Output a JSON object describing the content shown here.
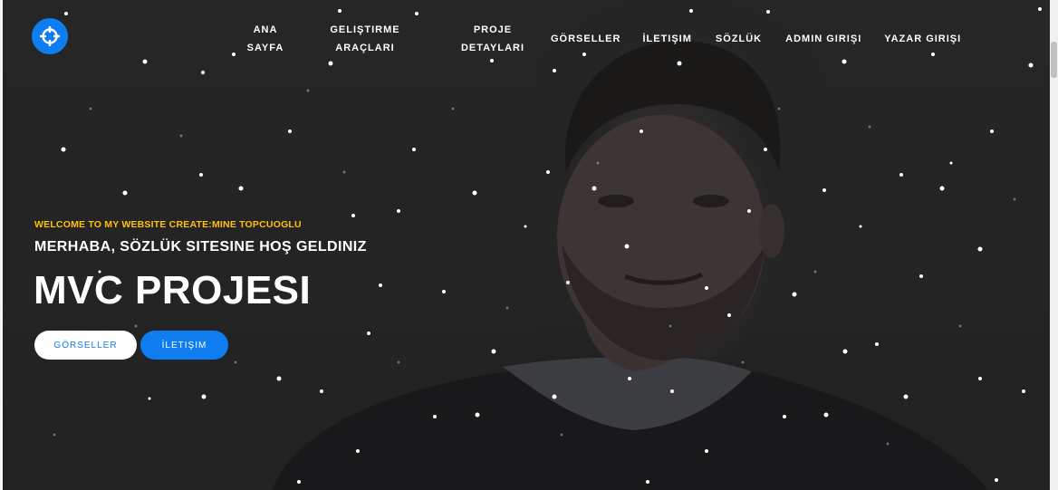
{
  "nav": {
    "items": [
      {
        "label_line1": "ANA",
        "label_line2": "SAYFA"
      },
      {
        "label_line1": "GELIŞTIRME",
        "label_line2": "ARAÇLARI"
      },
      {
        "label_line1": "PROJE",
        "label_line2": "DETAYLARI"
      },
      {
        "label_line1": "GÖRSELLER",
        "label_line2": ""
      },
      {
        "label_line1": "İLETIŞIM",
        "label_line2": ""
      },
      {
        "label_line1": "SÖZLÜK",
        "label_line2": ""
      },
      {
        "label_line1": "ADMIN GIRIŞI",
        "label_line2": ""
      },
      {
        "label_line1": "YAZAR GIRIŞI",
        "label_line2": ""
      }
    ]
  },
  "logo": {
    "icon": "crosshair-icon"
  },
  "hero": {
    "welcome": "WELCOME TO MY WEBSITE CREATE:MINE TOPCUOGLU",
    "subtitle": "MERHABA, SÖZLÜK SITESINE HOŞ GELDINIZ",
    "headline": "MVC PROJESI",
    "primary_button": "GÖRSELLER",
    "secondary_button": "İLETIŞIM"
  },
  "colors": {
    "accent": "#0f7cf0",
    "welcome": "#ffc107",
    "background": "#242424"
  }
}
